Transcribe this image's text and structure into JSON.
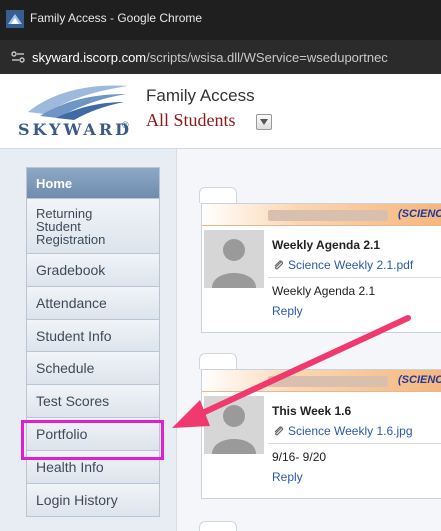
{
  "browser": {
    "window_title": "Family Access - Google Chrome",
    "url_host": "skyward.iscorp.com",
    "url_path": "/scripts/wsisa.dll/WService=wseduportnec"
  },
  "header": {
    "logo_text": "SKYWARD",
    "logo_mark": "®",
    "app_title": "Family Access",
    "student_select": "All Students"
  },
  "sidebar": {
    "items": [
      {
        "label": "Home"
      },
      {
        "label": "Returning Student Registration"
      },
      {
        "label": "Gradebook"
      },
      {
        "label": "Attendance"
      },
      {
        "label": "Student Info"
      },
      {
        "label": "Schedule"
      },
      {
        "label": "Test Scores"
      },
      {
        "label": "Portfolio"
      },
      {
        "label": "Health Info"
      },
      {
        "label": "Login History"
      }
    ]
  },
  "messages": [
    {
      "subject": "(SCIENC",
      "title": "Weekly Agenda 2.1",
      "attachment": "Science Weekly 2.1.pdf",
      "body": "Weekly Agenda 2.1",
      "reply": "Reply"
    },
    {
      "subject": "(SCIENC",
      "title": "This Week 1.6",
      "attachment": "Science Weekly 1.6.jpg",
      "body": "9/16- 9/20",
      "reply": "Reply"
    }
  ],
  "colors": {
    "highlight": "#e01fd2",
    "arrow": "#f03a6e",
    "nav_home": "#7f9bbd",
    "student_select": "#8b1a1a"
  }
}
